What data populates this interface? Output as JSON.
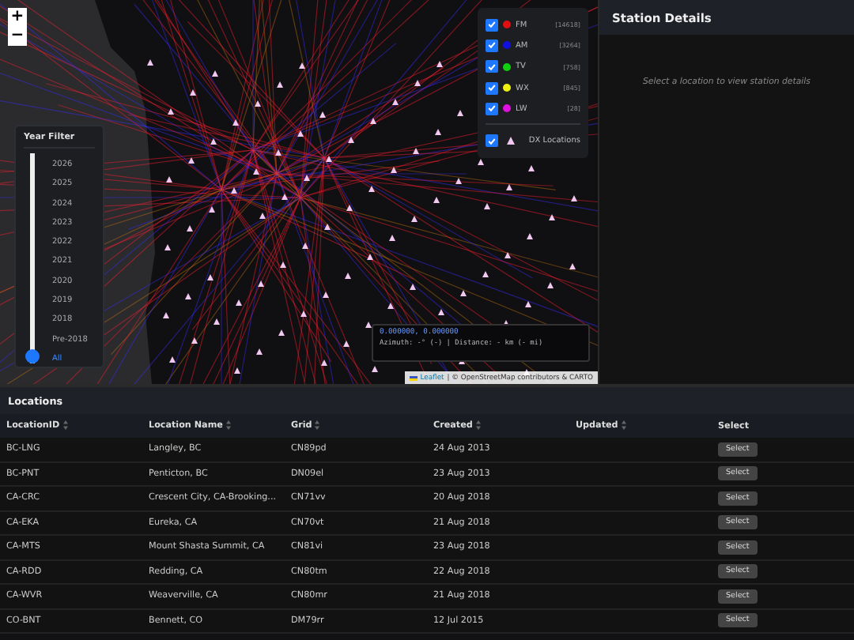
{
  "map": {
    "zoom_buttons": [
      "+",
      "−"
    ],
    "year_filter": {
      "title": "Year Filter",
      "options": [
        {
          "label": "2026",
          "selected": false
        },
        {
          "label": "2025",
          "selected": false
        },
        {
          "label": "2024",
          "selected": false
        },
        {
          "label": "2023",
          "selected": false
        },
        {
          "label": "2022",
          "selected": false
        },
        {
          "label": "2021",
          "selected": false
        },
        {
          "label": "2020",
          "selected": false
        },
        {
          "label": "2019",
          "selected": false
        },
        {
          "label": "2018",
          "selected": false
        },
        {
          "label": "Pre-2018",
          "selected": false
        },
        {
          "label": "All",
          "selected": true
        }
      ]
    },
    "legend": [
      {
        "kind": "band",
        "label": "FM",
        "count": "[14618]",
        "color": "#e01010",
        "checked": true
      },
      {
        "kind": "band",
        "label": "AM",
        "count": "[3264]",
        "color": "#1010e0",
        "checked": true
      },
      {
        "kind": "band",
        "label": "TV",
        "count": "[758]",
        "color": "#10d010",
        "checked": true
      },
      {
        "kind": "band",
        "label": "WX",
        "count": "[845]",
        "color": "#f0f010",
        "checked": true
      },
      {
        "kind": "band",
        "label": "LW",
        "count": "[28]",
        "color": "#e010e0",
        "checked": true
      },
      {
        "kind": "locations",
        "label": "DX Locations",
        "checked": true
      }
    ],
    "coordinates": "0.000000, 0.000000",
    "azimuth": "Azimuth: -° (-) | Distance: - km (- mi)",
    "attribution": {
      "link": "Leaflet",
      "text": "| © OpenStreetMap contributors & CARTO"
    }
  },
  "station_details": {
    "title": "Station Details",
    "placeholder": "Select a location to view station details"
  },
  "locations": {
    "title": "Locations",
    "columns": [
      {
        "label": "LocationID",
        "sortable": true
      },
      {
        "label": "Location Name",
        "sortable": true
      },
      {
        "label": "Grid",
        "sortable": true
      },
      {
        "label": "Created",
        "sortable": true
      },
      {
        "label": "Updated",
        "sortable": true
      },
      {
        "label": "Select",
        "sortable": false
      }
    ],
    "rows": [
      {
        "id": "BC-LNG",
        "name": "Langley, BC",
        "grid": "CN89pd",
        "created": "24 Aug 2013",
        "button": "Select"
      },
      {
        "id": "BC-PNT",
        "name": "Penticton, BC",
        "grid": "DN09el",
        "created": "23 Aug 2013",
        "button": "Select"
      },
      {
        "id": "CA-CRC",
        "name": "Crescent City, CA-Brooking...",
        "grid": "CN71vv",
        "created": "20 Aug 2018",
        "button": "Select"
      },
      {
        "id": "CA-EKA",
        "name": "Eureka, CA",
        "grid": "CN70vt",
        "created": "21 Aug 2018",
        "button": "Select"
      },
      {
        "id": "CA-MTS",
        "name": "Mount Shasta Summit, CA",
        "grid": "CN81vi",
        "created": "23 Aug 2018",
        "button": "Select"
      },
      {
        "id": "CA-RDD",
        "name": "Redding, CA",
        "grid": "CN80tm",
        "created": "22 Aug 2018",
        "button": "Select"
      },
      {
        "id": "CA-WVR",
        "name": "Weaverville, CA",
        "grid": "CN80mr",
        "created": "21 Aug 2018",
        "button": "Select"
      },
      {
        "id": "CO-BNT",
        "name": "Bennett, CO",
        "grid": "DM79rr",
        "created": "12 Jul 2015",
        "button": "Select"
      }
    ]
  }
}
